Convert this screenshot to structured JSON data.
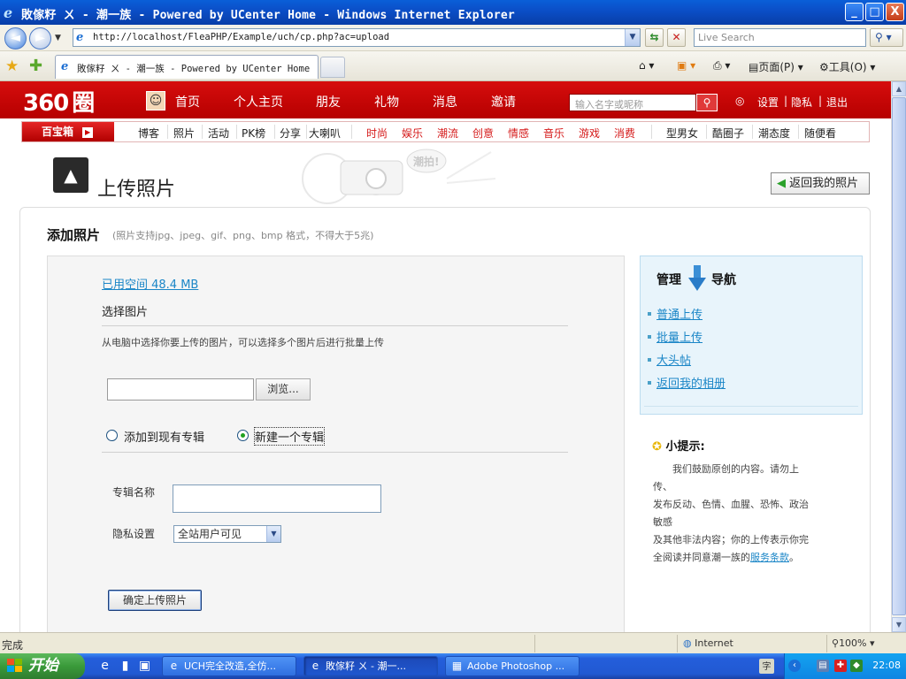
{
  "window": {
    "title": "敗傢籽 ㄨ - 潮一族 - Powered by UCenter Home - Windows Internet Explorer",
    "minimize": "_",
    "maximize": "□",
    "close": "X"
  },
  "address": {
    "url": "http://localhost/FleaPHP/Example/uch/cp.php?ac=upload",
    "search_placeholder": "Live Search"
  },
  "tab": {
    "label": "敗傢籽 ㄨ - 潮一族 - Powered by UCenter Home"
  },
  "commands": {
    "page": "页面(P)",
    "tools": "工具(O)"
  },
  "site": {
    "logo_num": "360",
    "logo_text": "圈",
    "nav": [
      "首页",
      "个人主页",
      "朋友",
      "礼物",
      "消息",
      "邀请"
    ],
    "search_placeholder": "输入名字或昵称",
    "settings": "设置",
    "privacy": "隐私",
    "logout": "退出",
    "sep": "|"
  },
  "catbar": {
    "baibao": "百宝箱",
    "black_items_1": [
      "博客",
      "照片",
      "活动",
      "PK榜",
      "分享",
      "大喇叭"
    ],
    "red_items": [
      "时尚",
      "娱乐",
      "潮流",
      "创意",
      "情感",
      "音乐",
      "游戏",
      "消费"
    ],
    "black_items_2": [
      "型男女",
      "酷圈子",
      "潮态度",
      "随便看"
    ]
  },
  "page": {
    "title": "上传照片",
    "back_button": "返回我的照片",
    "deco_text": "潮拍!"
  },
  "upload": {
    "heading": "添加照片",
    "note": "(照片支持jpg、jpeg、gif、png、bmp 格式，不得大于5兆)",
    "used_space": "已用空间 48.4 MB",
    "select_heading": "选择图片",
    "description": "从电脑中选择你要上传的图片，可以选择多个图片后进行批量上传",
    "browse": "浏览...",
    "radio_existing": "添加到现有专辑",
    "radio_new": "新建一个专辑",
    "album_name_label": "专辑名称",
    "album_name_value": "",
    "privacy_label": "隐私设置",
    "privacy_value": "全站用户可见",
    "submit": "确定上传照片"
  },
  "sidebar": {
    "title_left": "管理",
    "title_right": "导航",
    "links": [
      "普通上传",
      "批量上传",
      "大头帖",
      "返回我的相册"
    ]
  },
  "tips": {
    "heading": "小提示:",
    "lines": [
      "　　我们鼓励原创的内容。请勿上",
      "传、",
      "发布反动、色情、血腥、恐怖、政治",
      "敏感",
      "及其他非法内容；你的上传表示你完",
      "全阅读并同意潮一族的"
    ],
    "terms_link": "服务条款",
    "terms_end": "。"
  },
  "status": {
    "left": "完成",
    "zone": "Internet",
    "zoom": "100%"
  },
  "taskbar": {
    "start": "开始",
    "tasks": [
      "UCH完全改造,全仿...",
      "敗傢籽 ㄨ - 潮一...",
      "Adobe Photoshop ..."
    ],
    "clock": "22:08"
  }
}
